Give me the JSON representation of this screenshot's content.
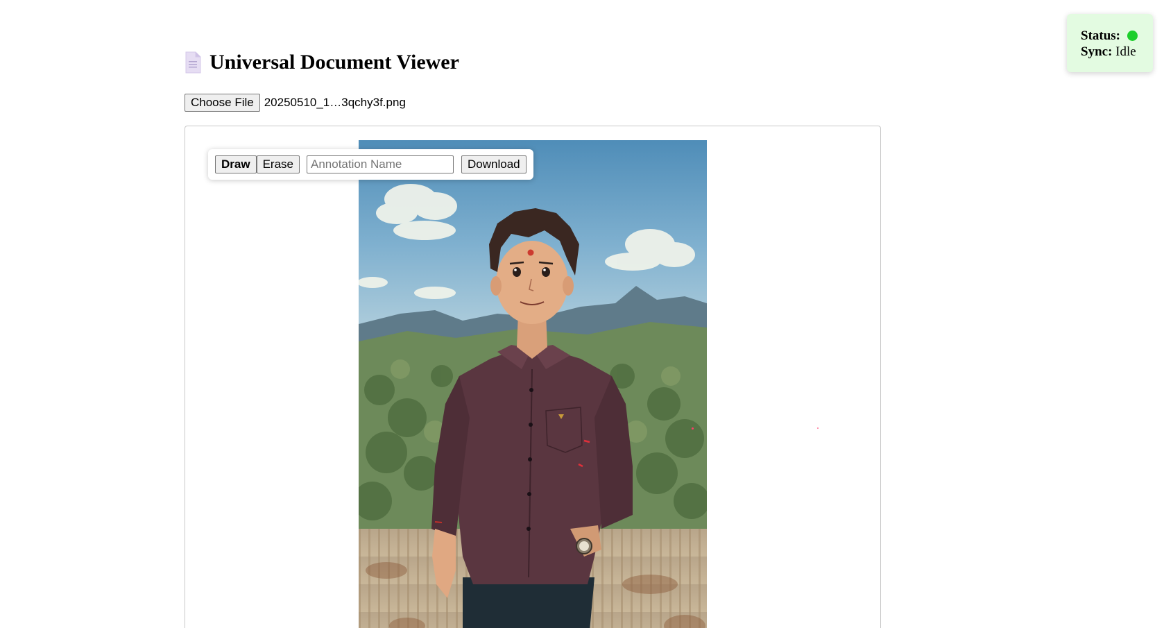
{
  "header": {
    "title": "Universal Document Viewer",
    "icon": "document-icon"
  },
  "file_input": {
    "button_label": "Choose File",
    "file_name": "20250510_1…3qchy3f.png"
  },
  "toolbar": {
    "draw_label": "Draw",
    "erase_label": "Erase",
    "annotation_placeholder": "Annotation Name",
    "annotation_value": "",
    "download_label": "Download",
    "active_tool": "Draw"
  },
  "status": {
    "status_label": "Status:",
    "status_color": "#1ccf2b",
    "sync_label": "Sync:",
    "sync_value": "Idle"
  },
  "image": {
    "description_name": "anime-style-portrait-image"
  },
  "colors": {
    "status_bg": "#e3fbe1",
    "annotation_mark": "#ff3b6a"
  }
}
